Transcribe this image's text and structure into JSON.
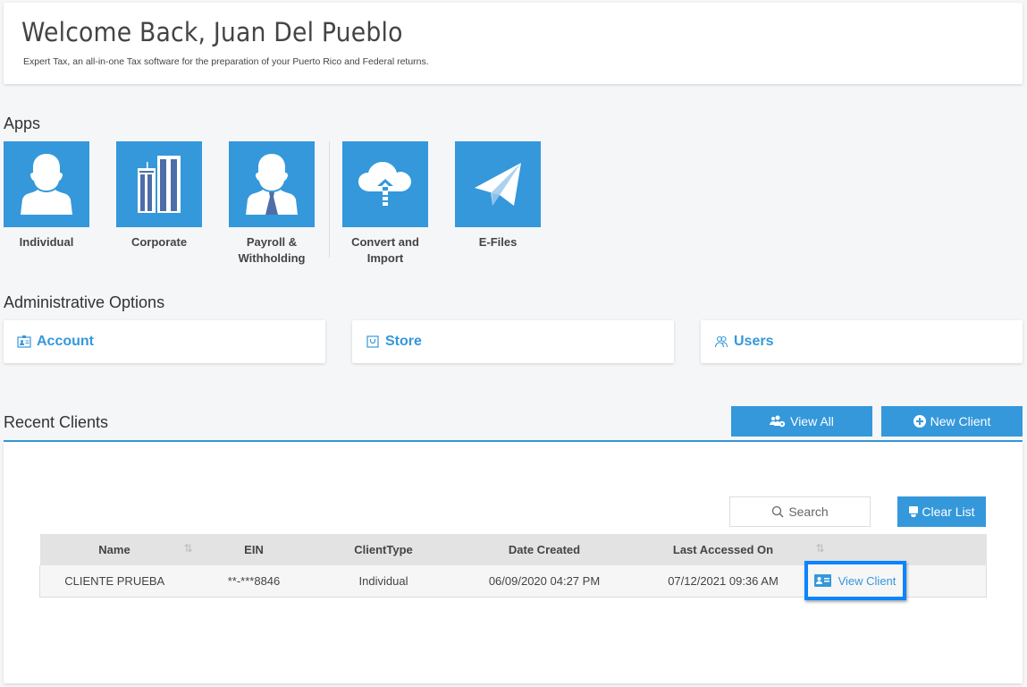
{
  "welcome": {
    "title": "Welcome Back, Juan Del Pueblo",
    "subtitle": "Expert Tax, an all-in-one Tax software for the preparation of your Puerto Rico and Federal returns."
  },
  "apps": {
    "title": "Apps",
    "items": [
      {
        "label_line1": "Individual",
        "label_line2": "",
        "icon": "person-icon"
      },
      {
        "label_line1": "Corporate",
        "label_line2": "",
        "icon": "buildings-icon"
      },
      {
        "label_line1": "Payroll &",
        "label_line2": "Withholding",
        "icon": "person-tie-icon"
      },
      {
        "label_line1": "Convert and",
        "label_line2": "Import",
        "icon": "cloud-upload-icon"
      },
      {
        "label_line1": "E-Files",
        "label_line2": "",
        "icon": "paper-plane-icon"
      }
    ]
  },
  "admin": {
    "title": "Administrative Options",
    "items": [
      {
        "label": "Account",
        "icon": "id-badge-icon"
      },
      {
        "label": "Store",
        "icon": "shopping-bag-icon"
      },
      {
        "label": "Users",
        "icon": "users-icon"
      }
    ]
  },
  "recent_clients": {
    "title": "Recent Clients",
    "view_all_label": "View All",
    "new_client_label": "New Client",
    "search_placeholder": "Search",
    "clear_list_label": "Clear List",
    "columns": [
      "Name",
      "EIN",
      "ClientType",
      "Date Created",
      "Last Accessed On",
      ""
    ],
    "rows": [
      {
        "name": "CLIENTE PRUEBA",
        "ein": "**-***8846",
        "client_type": "Individual",
        "date_created": "06/09/2020 04:27 PM",
        "last_accessed": "07/12/2021 09:36 AM",
        "action_label": "View Client"
      }
    ]
  },
  "colors": {
    "accent": "#3498db",
    "highlight": "#0a84ff",
    "background": "#f5f6f8"
  }
}
